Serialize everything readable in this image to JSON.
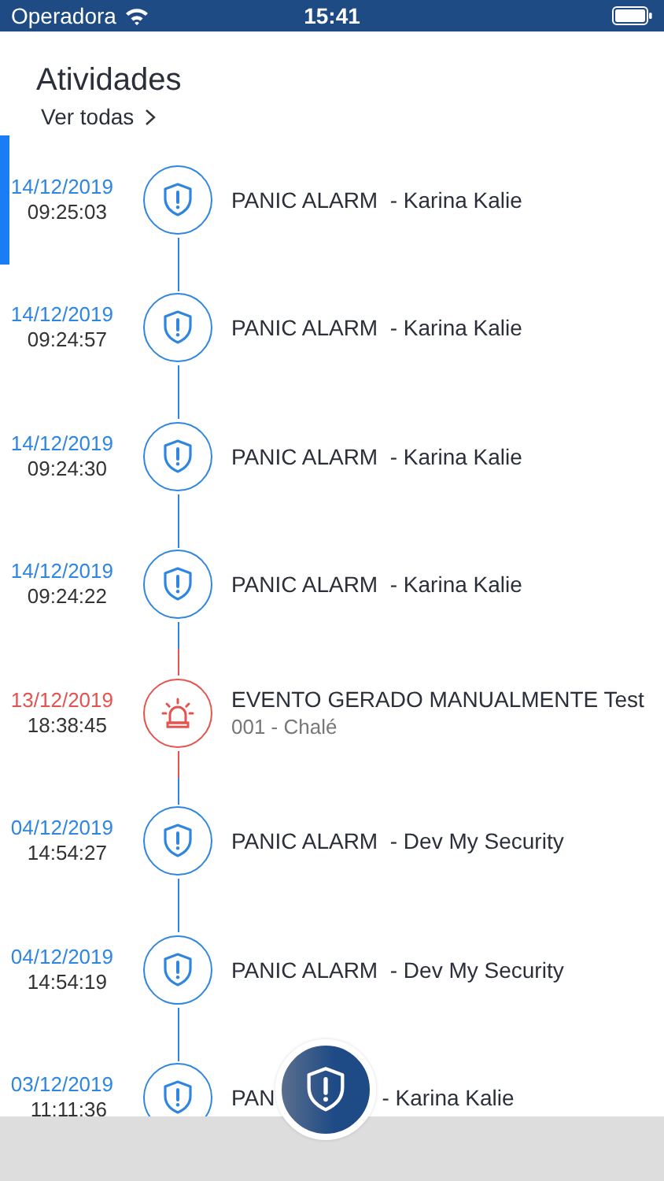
{
  "status_bar": {
    "carrier": "Operadora",
    "time": "15:41"
  },
  "header": {
    "title": "Atividades",
    "link": "Ver todas"
  },
  "activities": [
    {
      "kind": "panic",
      "selected": true,
      "date": "14/12/2019",
      "time": "09:25:03",
      "title": "PANIC ALARM  - Karina Kalie"
    },
    {
      "kind": "panic",
      "selected": false,
      "date": "14/12/2019",
      "time": "09:24:57",
      "title": "PANIC ALARM  - Karina Kalie"
    },
    {
      "kind": "panic",
      "selected": false,
      "date": "14/12/2019",
      "time": "09:24:30",
      "title": "PANIC ALARM  - Karina Kalie"
    },
    {
      "kind": "panic",
      "selected": false,
      "date": "14/12/2019",
      "time": "09:24:22",
      "title": "PANIC ALARM  - Karina Kalie"
    },
    {
      "kind": "manual",
      "selected": false,
      "date": "13/12/2019",
      "time": "18:38:45",
      "title": "EVENTO GERADO MANUALMENTE Test",
      "subtitle": "001 - Chalé"
    },
    {
      "kind": "panic",
      "selected": false,
      "date": "04/12/2019",
      "time": "14:54:27",
      "title": "PANIC ALARM  - Dev My Security"
    },
    {
      "kind": "panic",
      "selected": false,
      "date": "04/12/2019",
      "time": "14:54:19",
      "title": "PANIC ALARM  - Dev My Security"
    },
    {
      "kind": "panic",
      "selected": false,
      "date": "03/12/2019",
      "time": "11:11:36",
      "title": "PAN",
      "title_end": "- Karina Kalie"
    }
  ]
}
